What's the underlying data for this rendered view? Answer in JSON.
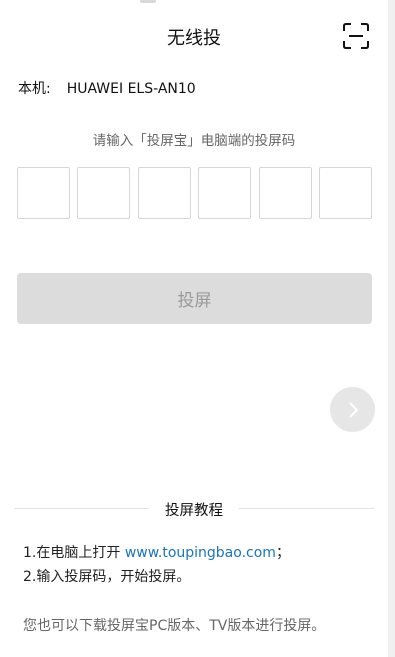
{
  "header": {
    "title": "无线投",
    "scan_icon": "scan-icon"
  },
  "device": {
    "label": "本机:",
    "name": "HUAWEI ELS-AN10"
  },
  "hint": "请输入「投屏宝」电脑端的投屏码",
  "code_boxes": [
    "",
    "",
    "",
    "",
    "",
    ""
  ],
  "cast_button": "投屏",
  "next_icon": "chevron-right-icon",
  "tutorial": {
    "title": "投屏教程",
    "step1_prefix": "1.在电脑上打开 ",
    "step1_link": "www.toupingbao.com",
    "step1_suffix": "；",
    "step2": "2.输入投屏码，开始投屏。"
  },
  "footer_note": "您也可以下载投屏宝PC版本、TV版本进行投屏。",
  "colors": {
    "link": "#1a73c2",
    "button_disabled_bg": "#dcdcdc",
    "button_disabled_text": "#9a9a9a"
  }
}
